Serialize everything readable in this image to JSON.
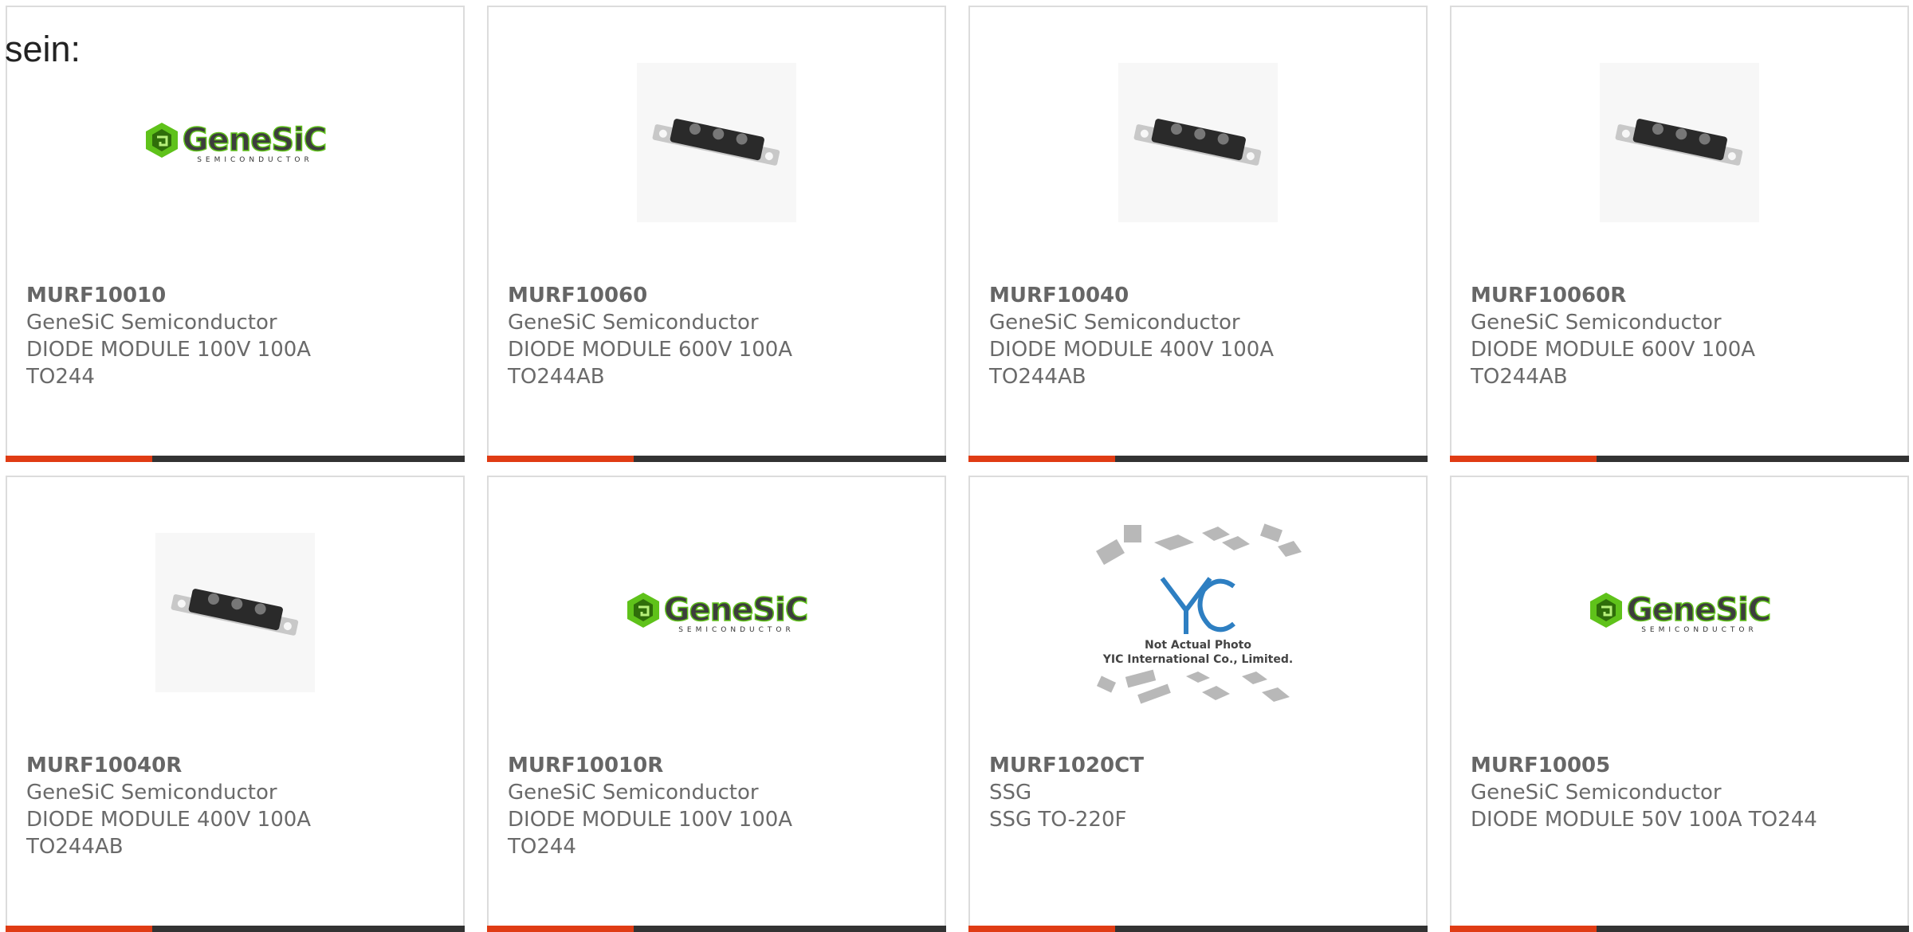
{
  "intro_text": "sein:",
  "colors": {
    "accent": "#e03c14",
    "bar": "#333333",
    "border": "#dcdcdc",
    "text": "#6a6a6a",
    "logo_green": "#5fc21a"
  },
  "products": [
    {
      "part": "MURF10010",
      "maker": "GeneSiC Semiconductor",
      "desc": "DIODE MODULE 100V 100A",
      "pkg": "TO244",
      "image": "genesic-logo"
    },
    {
      "part": "MURF10060",
      "maker": "GeneSiC Semiconductor",
      "desc": "DIODE MODULE 600V 100A",
      "pkg": "TO244AB",
      "image": "diode-module-photo"
    },
    {
      "part": "MURF10040",
      "maker": "GeneSiC Semiconductor",
      "desc": "DIODE MODULE 400V 100A",
      "pkg": "TO244AB",
      "image": "diode-module-photo"
    },
    {
      "part": "MURF10060R",
      "maker": "GeneSiC Semiconductor",
      "desc": "DIODE MODULE 600V 100A",
      "pkg": "TO244AB",
      "image": "diode-module-photo"
    },
    {
      "part": "MURF10040R",
      "maker": "GeneSiC Semiconductor",
      "desc": "DIODE MODULE 400V 100A",
      "pkg": "TO244AB",
      "image": "diode-module-photo"
    },
    {
      "part": "MURF10010R",
      "maker": "GeneSiC Semiconductor",
      "desc": "DIODE MODULE 100V 100A",
      "pkg": "TO244",
      "image": "genesic-logo"
    },
    {
      "part": "MURF1020CT",
      "maker": "SSG",
      "desc": "SSG TO-220F",
      "pkg": "",
      "image": "yic-placeholder"
    },
    {
      "part": "MURF10005",
      "maker": "GeneSiC Semiconductor",
      "desc": "DIODE MODULE 50V 100A TO244",
      "pkg": "",
      "image": "genesic-logo"
    }
  ],
  "logo": {
    "word": "GeneSiC",
    "sub": "SEMICONDUCTOR"
  },
  "yic": {
    "line1": "Not Actual Photo",
    "line2": "YIC International Co., Limited."
  }
}
